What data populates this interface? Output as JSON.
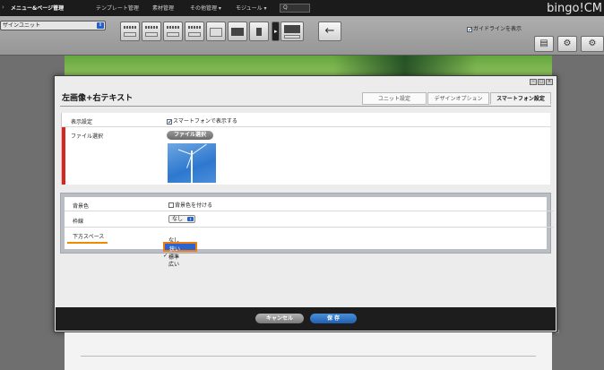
{
  "menubar": {
    "items": [
      "メニュー&ページ管理",
      "テンプレート管理",
      "素材管理",
      "その他管理 ▾",
      "モジュール ▾"
    ],
    "search_label": "Q",
    "brand": "bingo!CM"
  },
  "toolbar": {
    "unit_select_value": "ザインユニット",
    "back_icon": "←",
    "guide_label": "ガイドラインを表示",
    "guide_checked": true
  },
  "modal": {
    "title": "左画像+右テキスト",
    "tabs": [
      "ユニット設定",
      "デザインオプション",
      "スマートフォン設定"
    ],
    "active_tab": 2,
    "section1": {
      "display_label": "表示設定",
      "display_value": "スマートフォンで表示する",
      "file_label": "ファイル選択",
      "file_button": "ファイル選択"
    },
    "section2": {
      "bg_label": "背景色",
      "bg_value": "背景色を付ける",
      "border_label": "枠線",
      "border_value": "なし",
      "space_label": "下方スペース"
    },
    "dropdown": {
      "options": [
        "なし",
        "狭い",
        "標準",
        "広い"
      ],
      "highlighted": "狭い",
      "checked": "標準"
    },
    "cancel_label": "キャンセル",
    "save_label": "保 存"
  },
  "colors": {
    "accent_red": "#d8271e",
    "highlight_orange": "#ee7c12",
    "select_blue": "#2b63cf"
  }
}
